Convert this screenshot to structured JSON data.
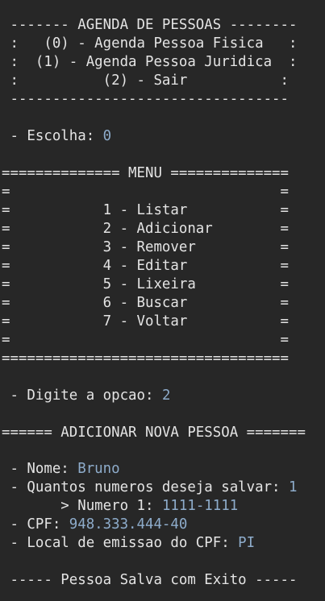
{
  "terminal": {
    "colors": {
      "background": "#272727",
      "text": "#e4e4e4",
      "input": "#8eaccb"
    },
    "agenda_header": {
      "title_line": " ------- AGENDA DE PESSOAS --------",
      "option0": " :   (0) - Agenda Pessoa Fisica   :",
      "option1": " :  (1) - Agenda Pessoa Juridica  :",
      "option2": " :          (2) - Sair           :",
      "bottom_line": " ---------------------------------"
    },
    "choice": {
      "label": " - Escolha: ",
      "value": "0"
    },
    "menu": {
      "top": "============== MENU ==============",
      "blank_top": "=                                =",
      "items": [
        "=           1 - Listar           =",
        "=           2 - Adicionar        =",
        "=           3 - Remover          =",
        "=           4 - Editar           =",
        "=           5 - Lixeira          =",
        "=           6 - Buscar           =",
        "=           7 - Voltar           ="
      ],
      "blank_bottom": "=                                =",
      "bottom": "=================================="
    },
    "option_prompt": {
      "label": " - Digite a opcao: ",
      "value": "2"
    },
    "add_header": "====== ADICIONAR NOVA PESSOA =======",
    "form": {
      "name": {
        "label": " - Nome: ",
        "value": "Bruno"
      },
      "count": {
        "label": " - Quantos numeros deseja salvar: ",
        "value": "1"
      },
      "number1": {
        "label": "       > Numero 1: ",
        "value": "1111-1111"
      },
      "cpf": {
        "label": " - CPF: ",
        "value": "948.333.444-40"
      },
      "issuer": {
        "label": " - Local de emissao do CPF: ",
        "value": "PI"
      }
    },
    "success": " ----- Pessoa Salva com Exito -----"
  }
}
